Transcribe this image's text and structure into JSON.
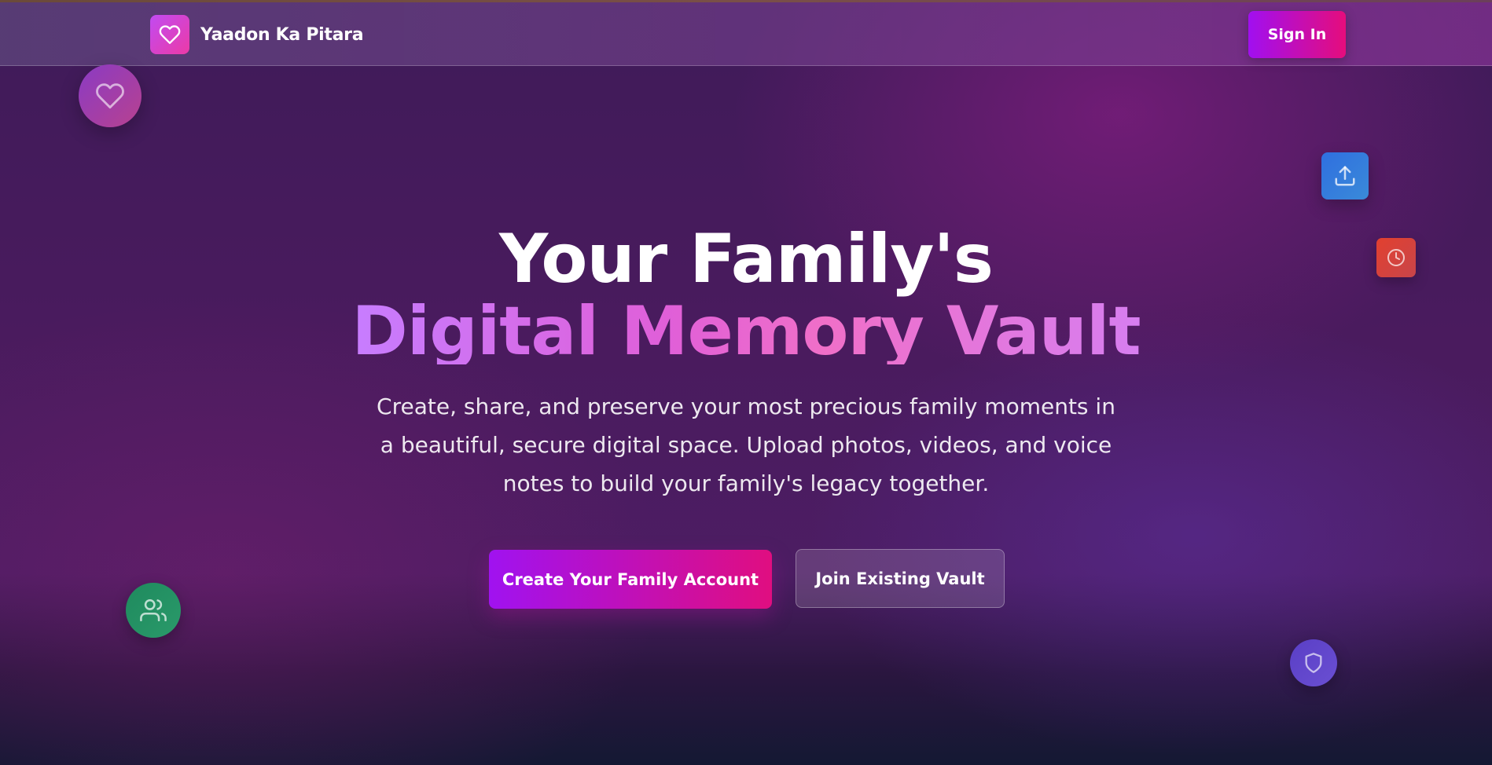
{
  "colors": {
    "accent_purple": "#a10ff0",
    "accent_pink": "#e50d7c",
    "background_top": "#3f1b59",
    "background_bottom": "#141833"
  },
  "header": {
    "brand_name": "Yaadon Ka Pitara",
    "logo_icon": "heart-icon",
    "signin_label": "Sign In"
  },
  "hero": {
    "title_line1": "Your Family's",
    "title_line2": "Digital Memory Vault",
    "description": "Create, share, and preserve your most precious family moments in a beautiful, secure digital space. Upload photos, videos, and voice notes to build your family's legacy together.",
    "primary_cta": "Create Your Family Account",
    "secondary_cta": "Join Existing Vault"
  },
  "floating_icons": [
    "heart-icon",
    "upload-icon",
    "clock-icon",
    "users-icon",
    "shield-icon"
  ]
}
